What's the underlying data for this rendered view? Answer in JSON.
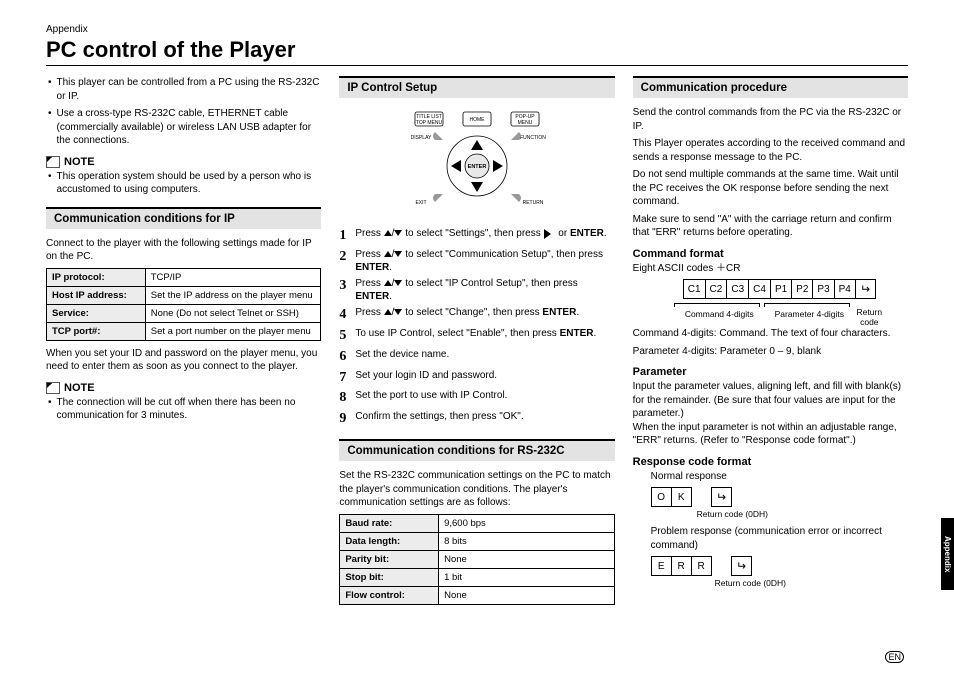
{
  "header": {
    "appendix": "Appendix",
    "title": "PC control of the Player"
  },
  "col1": {
    "intro_bullets": [
      "This player can be controlled from a PC using the RS-232C or IP.",
      "Use a cross-type RS-232C cable, ETHERNET cable (commercially available) or wireless LAN USB adapter for the connections."
    ],
    "note_label": "NOTE",
    "note1": "This operation system should be used by a person who is accustomed to using computers.",
    "sec_ip_cond": "Communication conditions for IP",
    "ip_cond_intro": "Connect to the player with the following settings made for IP on the PC.",
    "ip_table": [
      [
        "IP protocol:",
        "TCP/IP"
      ],
      [
        "Host IP address:",
        "Set the IP address on the player menu"
      ],
      [
        "Service:",
        "None (Do not select Telnet or SSH)"
      ],
      [
        "TCP port#:",
        "Set a port number on the player menu"
      ]
    ],
    "ip_after": "When you set your ID and password on the player menu, you need to enter them as soon as you connect to the player.",
    "note2": "The connection will be cut off when there has been no communication for 3 minutes."
  },
  "col2": {
    "sec_setup": "IP Control Setup",
    "remote_labels": {
      "tl": "TITLE LIST\nTOP MENU",
      "home": "HOME",
      "tr": "POP-UP\nMENU",
      "ml": "DISPLAY",
      "mr": "FUNCTION",
      "bl": "EXIT",
      "br": "RETURN",
      "center": "ENTER"
    },
    "steps": [
      "Press ▲/▼ to select \"Settings\", then press ▶ or ENTER.",
      "Press ▲/▼ to select \"Communication Setup\", then press ENTER.",
      "Press ▲/▼ to select \"IP Control Setup\", then press ENTER.",
      "Press ▲/▼ to select \"Change\", then press ENTER.",
      "To use IP Control, select \"Enable\", then press ENTER.",
      "Set the device name.",
      "Set your login ID and password.",
      "Set the port to use with IP Control.",
      "Confirm the settings, then press \"OK\"."
    ],
    "sec_rs232": "Communication conditions for RS-232C",
    "rs232_intro": "Set the RS-232C communication settings on the PC to match the player's communication conditions. The player's communication settings are as follows:",
    "rs232_table": [
      [
        "Baud rate:",
        "9,600 bps"
      ],
      [
        "Data length:",
        "8 bits"
      ],
      [
        "Parity bit:",
        "None"
      ],
      [
        "Stop bit:",
        "1 bit"
      ],
      [
        "Flow control:",
        "None"
      ]
    ]
  },
  "col3": {
    "sec_proc": "Communication procedure",
    "proc_paras": [
      "Send the control commands from the PC via the RS-232C or IP.",
      "This Player operates according to the received command and sends a response message to the PC.",
      "Do not send multiple commands at the same time. Wait until the PC receives the OK response before sending the next command.",
      "Make sure to send \"A\" with the carriage return and confirm that \"ERR\" returns before operating."
    ],
    "cmd_format_hdr": "Command format",
    "cmd_format_sub": "Eight ASCII codes ＋CR",
    "cmd_cells": [
      "C1",
      "C2",
      "C3",
      "C4",
      "P1",
      "P2",
      "P3",
      "P4",
      "↵"
    ],
    "cmd_lbl1": "Command 4-digits",
    "cmd_lbl2": "Parameter 4-digits",
    "cmd_lbl3": "Return code",
    "cmd_after": [
      "Command 4-digits: Command. The text of four characters.",
      "Parameter 4-digits: Parameter 0 – 9, blank"
    ],
    "param_hdr": "Parameter",
    "param_text": "Input the parameter values, aligning left, and fill with blank(s) for the remainder. (Be sure that four values are input for the parameter.)\nWhen the input parameter is not within an adjustable range, \"ERR\" returns. (Refer to \"Response code format\".)",
    "resp_hdr": "Response code format",
    "resp_normal": "Normal response",
    "resp_ok": [
      "O",
      "K",
      "↵"
    ],
    "resp_ret": "Return code (0DH)",
    "resp_problem": "Problem response (communication error or incorrect command)",
    "resp_err": [
      "E",
      "R",
      "R",
      "↵"
    ],
    "side_tab": "Appendix",
    "footer_en": "EN"
  }
}
